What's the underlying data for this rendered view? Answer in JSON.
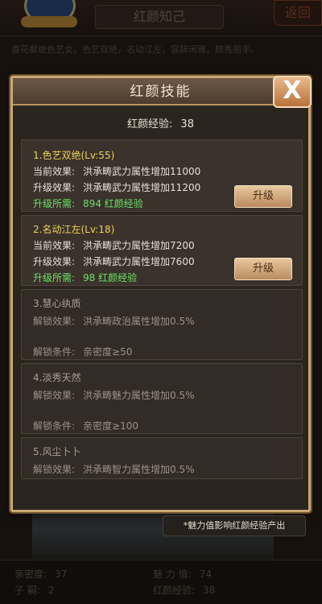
{
  "background": {
    "title": "红颜知己",
    "back_label": "返回",
    "description": "香花樨绝色艺女，色艺双绝，名动江左，容辞闲雅，颇秀丽手。",
    "stats": {
      "intimacy_label": "亲密度:",
      "intimacy_value": "37",
      "charm_label": "魅 力 值:",
      "charm_value": "74",
      "children_label": "子  嗣:",
      "children_value": "2",
      "exp_label": "红颜经验:",
      "exp_value": "38"
    }
  },
  "modal": {
    "title": "红颜技能",
    "close_label": "X",
    "exp_label": "红颜经验:",
    "exp_value": "38",
    "skills": [
      {
        "title": "1.色艺双绝(Lv:55)",
        "current_label": "当前效果:",
        "current_value": "洪承畴武力属性增加11000",
        "next_label": "升级效果:",
        "next_value": "洪承畴武力属性增加11200",
        "cost_label": "升级所需:",
        "cost_value": "894  红颜经验",
        "button": "升级"
      },
      {
        "title": "2.名动江左(Lv:18)",
        "current_label": "当前效果:",
        "current_value": "洪承畴武力属性增加7200",
        "next_label": "升级效果:",
        "next_value": "洪承畴武力属性增加7600",
        "cost_label": "升级所需:",
        "cost_value": "98  红颜经验",
        "button": "升级"
      },
      {
        "title": "3.慧心纨质",
        "unlock_label": "解锁效果:",
        "unlock_value": "洪承畴政治属性增加0.5%",
        "cond_label": "解锁条件:",
        "cond_value": "亲密度≥50"
      },
      {
        "title": "4.淡秀天然",
        "unlock_label": "解锁效果:",
        "unlock_value": "洪承畴魅力属性增加0.5%",
        "cond_label": "解锁条件:",
        "cond_value": "亲密度≥100"
      },
      {
        "title": "5.风尘卜卜",
        "unlock_label": "解锁效果:",
        "unlock_value": "洪承畴智力属性增加0.5%"
      }
    ],
    "footer_note": "*魅力值影响红颜经验产出"
  }
}
